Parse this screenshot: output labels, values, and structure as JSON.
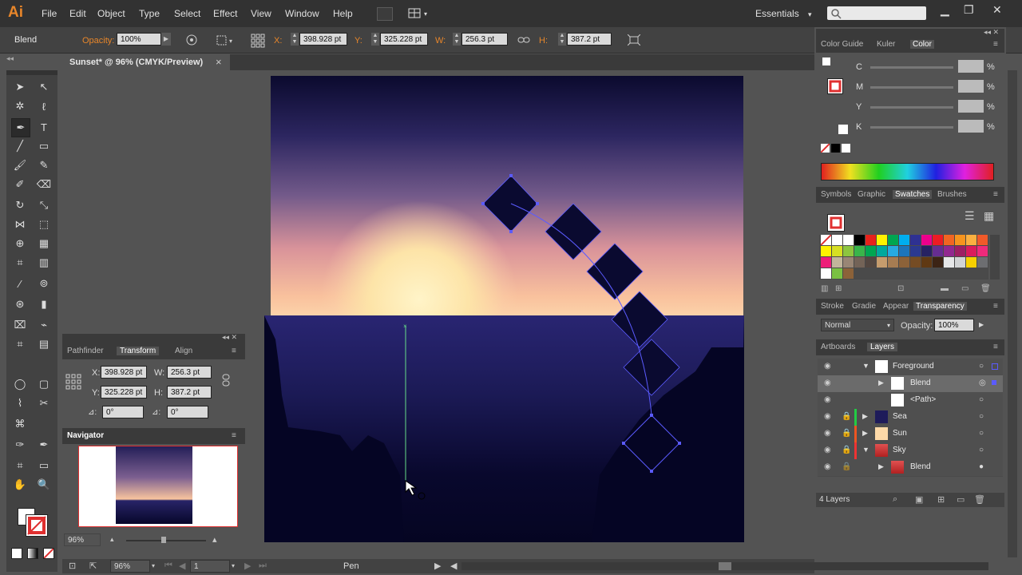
{
  "app": {
    "logo": "Ai",
    "workspace": "Essentials",
    "workspace_arrow": "▾"
  },
  "menu": [
    "File",
    "Edit",
    "Object",
    "Type",
    "Select",
    "Effect",
    "View",
    "Window",
    "Help"
  ],
  "controlbar": {
    "mode": "Blend",
    "opacity_label": "Opacity:",
    "opacity_value": "100%",
    "x_label": "X:",
    "x_value": "398.928 pt",
    "y_label": "Y:",
    "y_value": "325.228 pt",
    "w_label": "W:",
    "w_value": "256.3 pt",
    "h_label": "H:",
    "h_value": "387.2 pt"
  },
  "document": {
    "tab_title": "Sunset* @ 96% (CMYK/Preview)",
    "close": "×"
  },
  "transform_panel": {
    "tabs": [
      "Pathfinder",
      "Transform",
      "Align"
    ],
    "x_label": "X:",
    "x_value": "398.928 pt",
    "y_label": "Y:",
    "y_value": "325.228 pt",
    "w_label": "W:",
    "w_value": "256.3 pt",
    "h_label": "H:",
    "h_value": "387.2 pt",
    "angle_value": "0°",
    "shear_value": "0°"
  },
  "navigator": {
    "title": "Navigator",
    "zoom": "96%"
  },
  "color_panel": {
    "tabs": [
      "Color Guide",
      "Kuler",
      "Color"
    ],
    "channels": [
      {
        "label": "C",
        "unit": "%"
      },
      {
        "label": "M",
        "unit": "%"
      },
      {
        "label": "Y",
        "unit": "%"
      },
      {
        "label": "K",
        "unit": "%"
      }
    ]
  },
  "swatches_panel": {
    "tabs": [
      "Symbols",
      "Graphic",
      "Swatches",
      "Brushes"
    ]
  },
  "transparency_panel": {
    "tabs": [
      "Stroke",
      "Gradie",
      "Appear",
      "Transparency"
    ],
    "blend_mode": "Normal",
    "opacity_label": "Opacity:",
    "opacity_value": "100%"
  },
  "layers_panel": {
    "tabs": [
      "Artboards",
      "Layers"
    ],
    "rows": [
      {
        "name": "Foreground",
        "color": "#4f6df5"
      },
      {
        "name": "Blend",
        "color": "#4f6df5"
      },
      {
        "name": "<Path>",
        "color": "#4f6df5"
      },
      {
        "name": "Sea",
        "color": "#22cc44"
      },
      {
        "name": "Sun",
        "color": "#ee5522"
      },
      {
        "name": "Sky",
        "color": "#ee3333"
      },
      {
        "name": "Blend",
        "color": "#ee3333"
      }
    ],
    "count": "4 Layers"
  },
  "statusbar": {
    "zoom": "96%",
    "artboard": "1",
    "tool": "Pen"
  },
  "colors": {
    "accent": "#e8862a",
    "path_blue": "#5b5bff",
    "path_green": "#66dd88"
  }
}
